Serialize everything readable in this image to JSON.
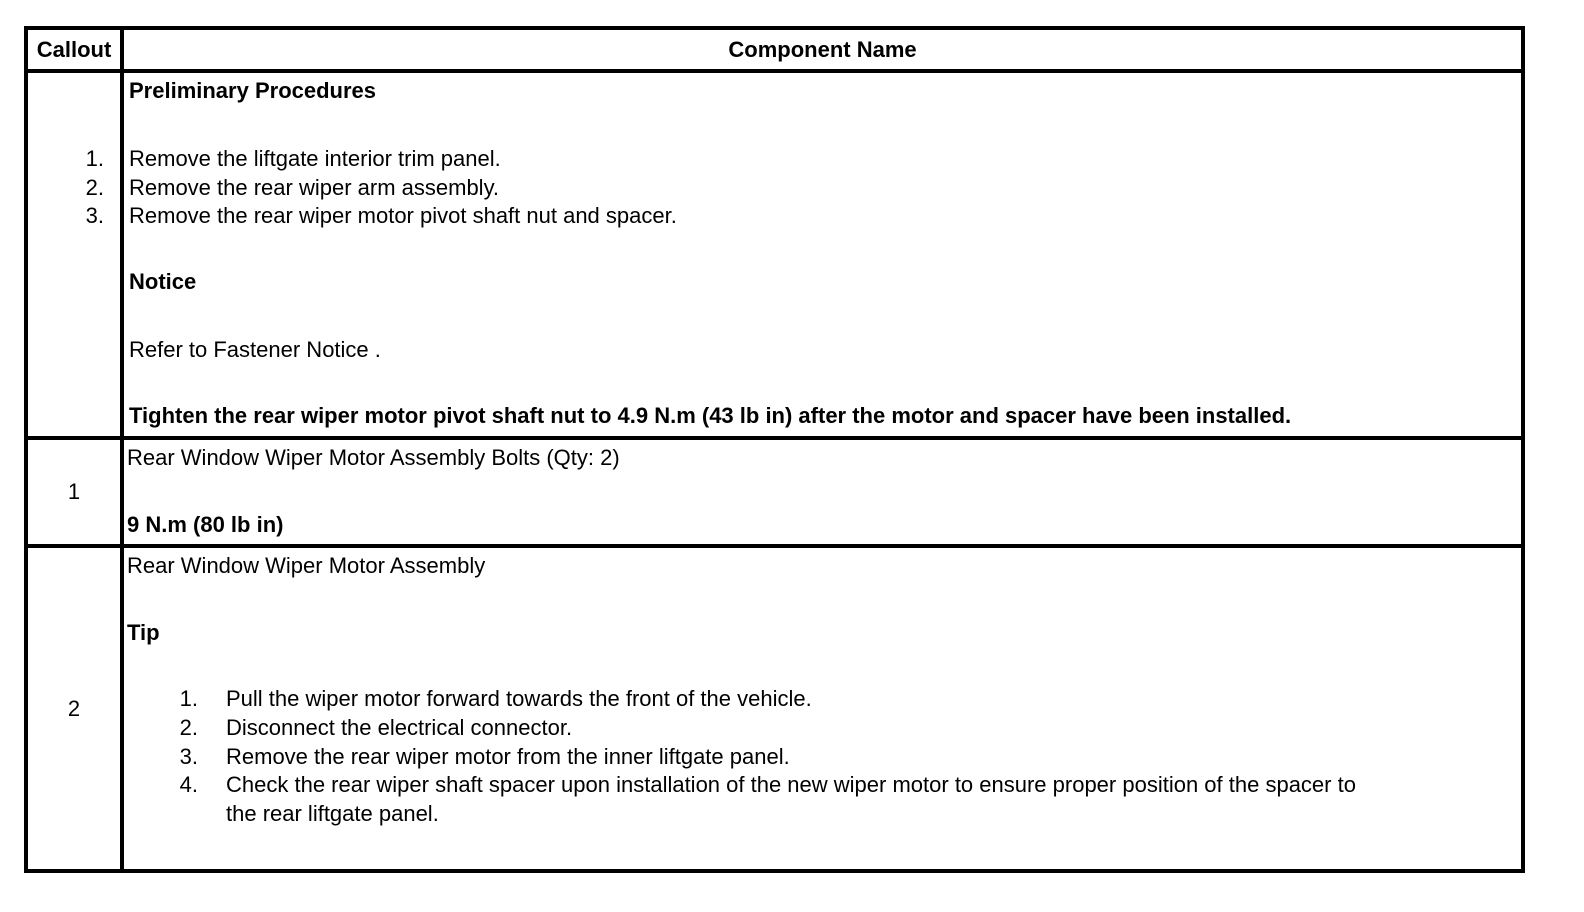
{
  "header": {
    "callout": "Callout",
    "component": "Component Name"
  },
  "preliminary": {
    "title": "Preliminary Procedures",
    "steps": [
      {
        "num": "1.",
        "text": "Remove the liftgate interior trim panel."
      },
      {
        "num": "2.",
        "text": "Remove the rear wiper arm assembly."
      },
      {
        "num": "3.",
        "text": "Remove the rear wiper motor pivot shaft nut and spacer."
      }
    ],
    "notice_title": "Notice",
    "notice_text": "Refer to Fastener Notice .",
    "tighten": "Tighten the rear wiper motor pivot shaft nut to 4.9 N.m (43 lb in) after the motor and spacer have been installed."
  },
  "row1": {
    "callout": "1",
    "name": "Rear Window Wiper Motor Assembly Bolts (Qty: 2)",
    "torque": "9 N.m (80 lb in)"
  },
  "row2": {
    "callout": "2",
    "name": "Rear Window Wiper Motor Assembly",
    "tip_title": "Tip",
    "steps": [
      {
        "num": "1.",
        "text": "Pull the wiper motor forward towards the front of the vehicle."
      },
      {
        "num": "2.",
        "text": "Disconnect the electrical connector."
      },
      {
        "num": "3.",
        "text": "Remove the rear wiper motor from the inner liftgate panel."
      },
      {
        "num": "4.",
        "text": "Check the rear wiper shaft spacer upon installation of the new wiper motor to ensure proper position of the spacer to",
        "cont": "the rear liftgate panel."
      }
    ]
  }
}
